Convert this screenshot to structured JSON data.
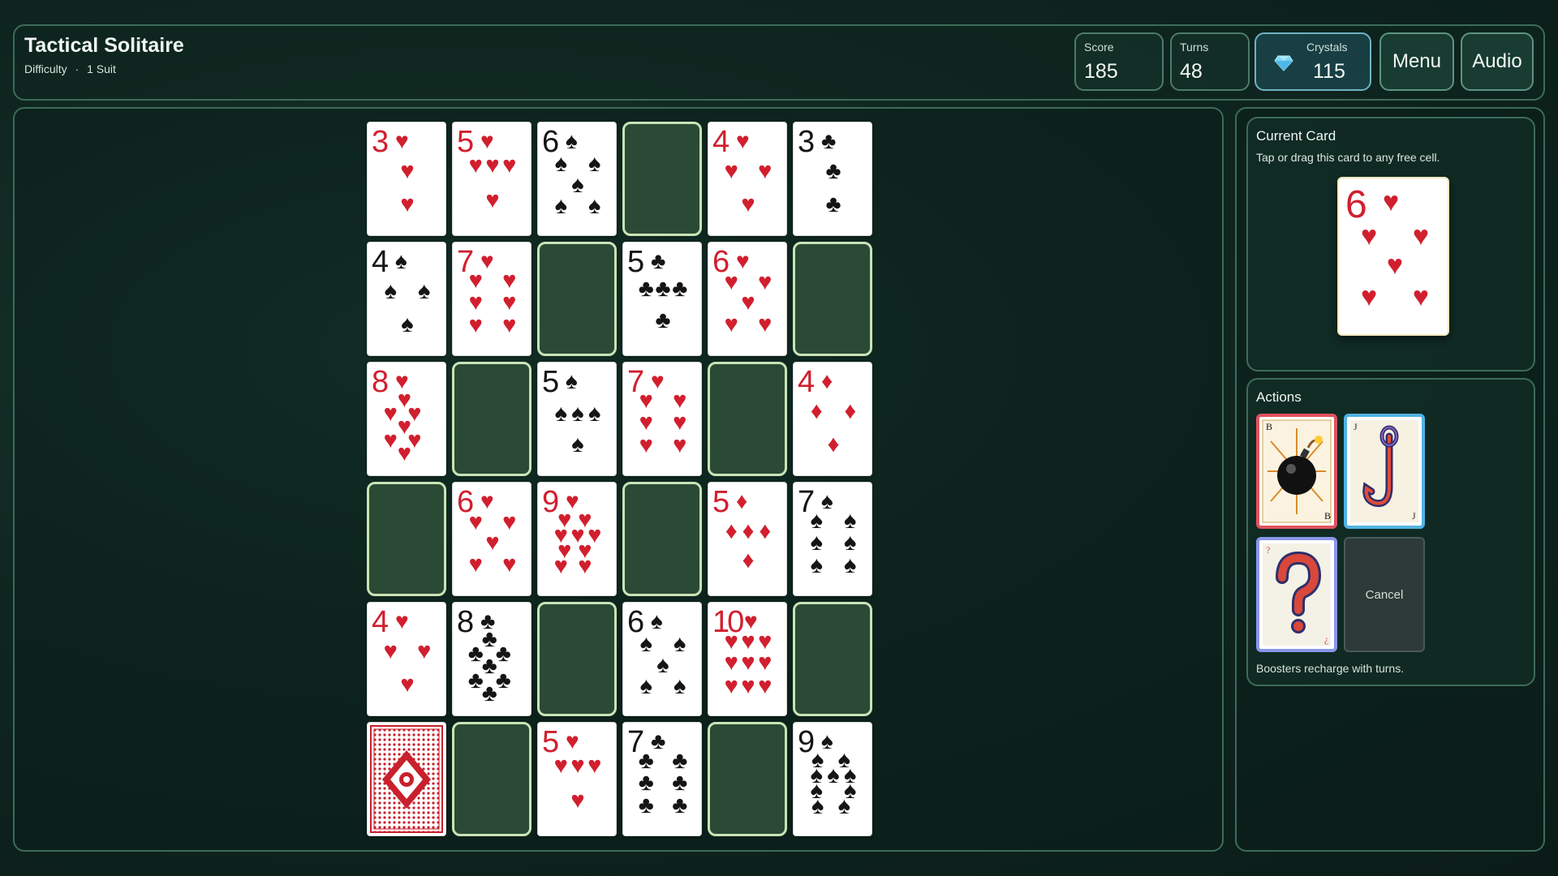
{
  "header": {
    "title": "Tactical Solitaire",
    "difficulty_label": "Difficulty",
    "separator": "·",
    "difficulty_value": "1 Suit",
    "score_label": "Score",
    "score_value": "185",
    "turns_label": "Turns",
    "turns_value": "48",
    "crystals_label": "Crystals",
    "crystals_value": "115",
    "menu_label": "Menu",
    "audio_label": "Audio"
  },
  "board": {
    "rows": [
      [
        {
          "rank": "3",
          "suit": "hearts"
        },
        {
          "rank": "5",
          "suit": "hearts"
        },
        {
          "rank": "6",
          "suit": "spades"
        },
        {
          "empty": true
        },
        {
          "rank": "4",
          "suit": "hearts"
        },
        {
          "rank": "3",
          "suit": "clubs"
        }
      ],
      [
        {
          "rank": "4",
          "suit": "spades"
        },
        {
          "rank": "7",
          "suit": "hearts"
        },
        {
          "empty": true
        },
        {
          "rank": "5",
          "suit": "clubs"
        },
        {
          "rank": "6",
          "suit": "hearts"
        },
        {
          "empty": true
        }
      ],
      [
        {
          "rank": "8",
          "suit": "hearts"
        },
        {
          "empty": true
        },
        {
          "rank": "5",
          "suit": "spades"
        },
        {
          "rank": "7",
          "suit": "hearts"
        },
        {
          "empty": true
        },
        {
          "rank": "4",
          "suit": "diamonds"
        }
      ],
      [
        {
          "empty": true
        },
        {
          "rank": "6",
          "suit": "hearts"
        },
        {
          "rank": "9",
          "suit": "hearts"
        },
        {
          "empty": true
        },
        {
          "rank": "5",
          "suit": "diamonds"
        },
        {
          "rank": "7",
          "suit": "spades"
        }
      ],
      [
        {
          "rank": "4",
          "suit": "hearts"
        },
        {
          "rank": "8",
          "suit": "clubs"
        },
        {
          "empty": true
        },
        {
          "rank": "6",
          "suit": "spades"
        },
        {
          "rank": "10",
          "suit": "hearts"
        },
        {
          "empty": true
        }
      ],
      [
        {
          "back": true
        },
        {
          "empty": true
        },
        {
          "rank": "5",
          "suit": "hearts"
        },
        {
          "rank": "7",
          "suit": "clubs"
        },
        {
          "empty": true
        },
        {
          "rank": "9",
          "suit": "spades"
        }
      ]
    ]
  },
  "current_card": {
    "title": "Current Card",
    "hint": "Tap or drag this card to any free cell.",
    "rank": "6",
    "suit": "hearts"
  },
  "actions": {
    "title": "Actions",
    "cancel_label": "Cancel",
    "note": "Boosters recharge with turns.",
    "boosters": [
      {
        "name": "bomb",
        "corner": "B",
        "color": "#e0525d"
      },
      {
        "name": "hook",
        "corner": "J",
        "color": "#4fb3e3"
      },
      {
        "name": "mystery",
        "corner": "?",
        "color": "#8a96e8"
      }
    ]
  },
  "colors": {
    "red_suit": "#d11f2e",
    "black_suit": "#151515",
    "empty_cell_fill": "#2b4a36",
    "empty_cell_border": "#c9e3b4",
    "card_back": "#c8202c"
  }
}
